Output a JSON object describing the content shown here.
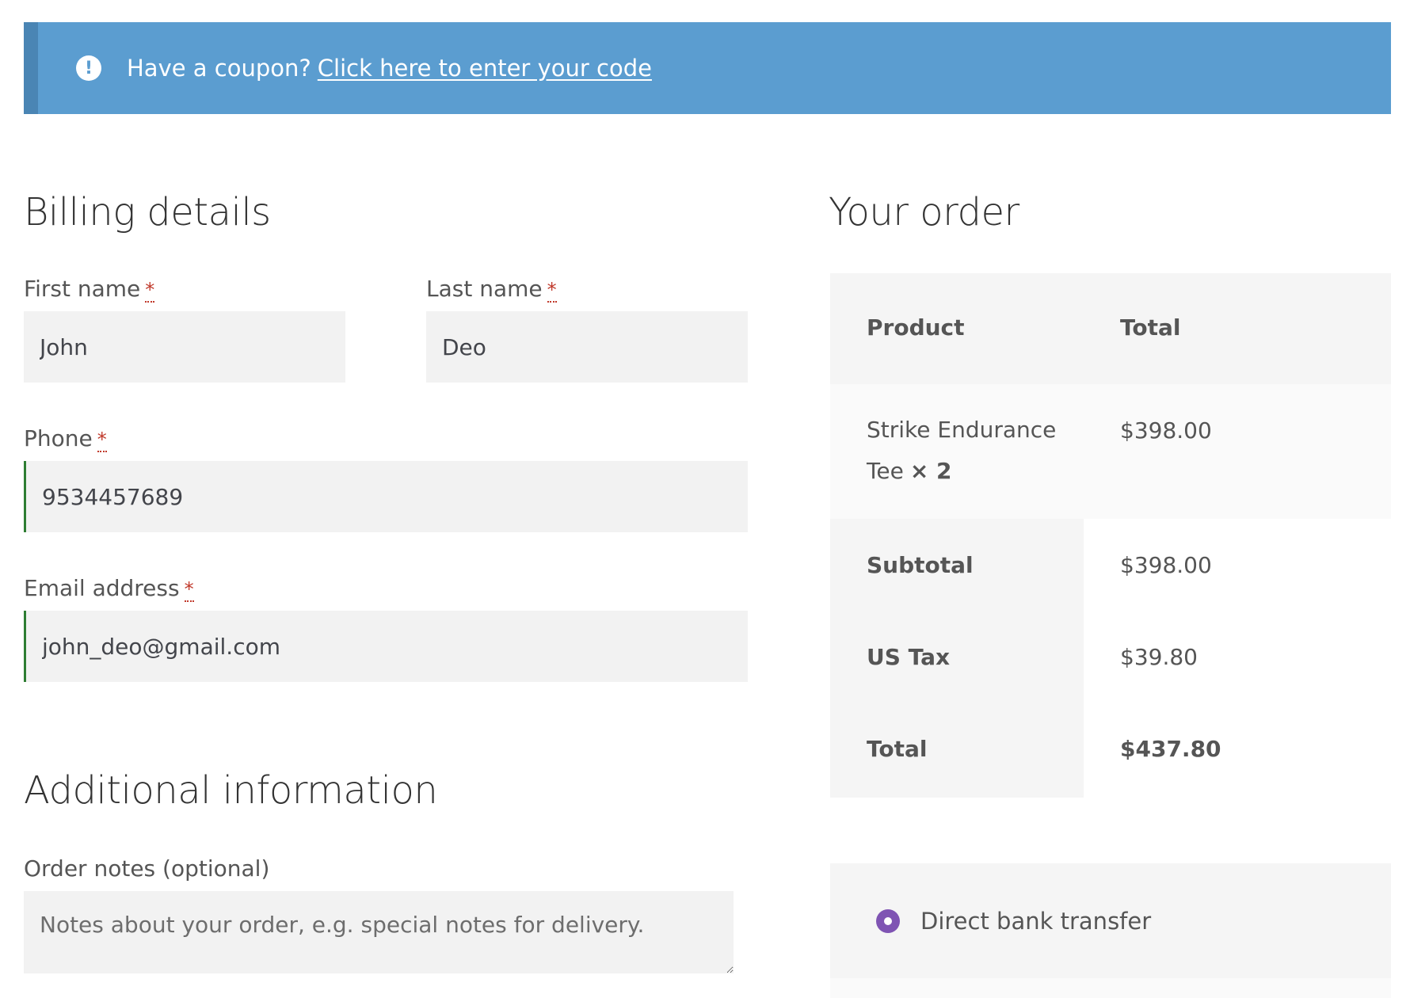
{
  "notice": {
    "text": "Have a coupon?",
    "link_text": "Click here to enter your code",
    "bg_color": "#5b9dd0"
  },
  "billing": {
    "title": "Billing details",
    "first_name": {
      "label": "First name",
      "value": "John"
    },
    "last_name": {
      "label": "Last name",
      "value": "Deo"
    },
    "phone": {
      "label": "Phone",
      "value": "9534457689"
    },
    "email": {
      "label": "Email address",
      "value": "john_deo@gmail.com"
    },
    "required_mark": "*"
  },
  "additional": {
    "title": "Additional information",
    "order_notes_label": "Order notes (optional)",
    "order_notes_placeholder": "Notes about your order, e.g. special notes for delivery."
  },
  "order": {
    "title": "Your order",
    "headers": {
      "product": "Product",
      "total": "Total"
    },
    "item": {
      "name": "Strike Endurance Tee",
      "qty": "× 2",
      "total": "$398.00"
    },
    "subtotal": {
      "label": "Subtotal",
      "value": "$398.00"
    },
    "tax": {
      "label": "US Tax",
      "value": "$39.80"
    },
    "grand_total": {
      "label": "Total",
      "value": "$437.80"
    }
  },
  "payment": {
    "method": "Direct bank transfer",
    "accent_color": "#7f54b3"
  }
}
